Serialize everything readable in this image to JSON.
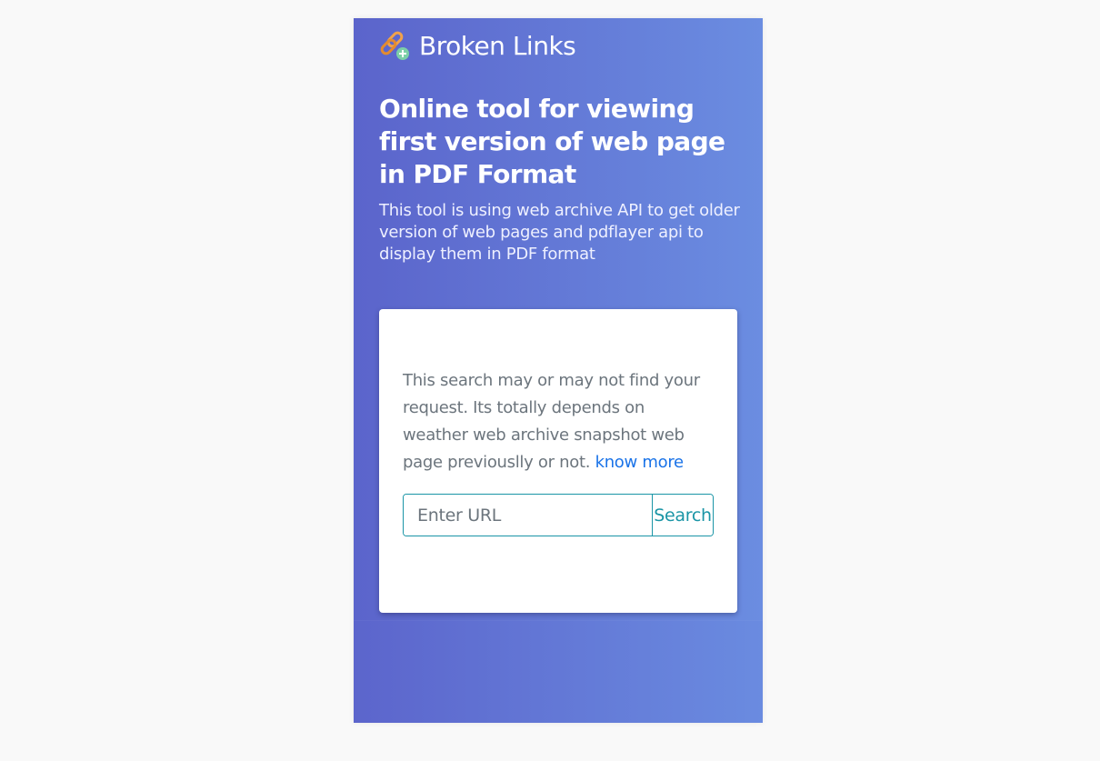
{
  "brand": {
    "name": "Broken Links",
    "icon": "chain-link-add-icon"
  },
  "hero": {
    "title": "Online tool for viewing first version of web page in PDF Format",
    "subtitle": "This tool is using web archive API to get older version of web pages and pdflayer api to display them in PDF format"
  },
  "card": {
    "notice": "This search may or may not find your request. Its totally depends on weather web archive snapshot web page previouslly or not.",
    "know_more": "know more"
  },
  "search": {
    "placeholder": "Enter URL",
    "value": "",
    "button_label": "Search"
  },
  "colors": {
    "gradient_start": "#5b64cb",
    "gradient_end": "#6b8de1",
    "accent": "#1a95a6",
    "link": "#1a73e8"
  }
}
